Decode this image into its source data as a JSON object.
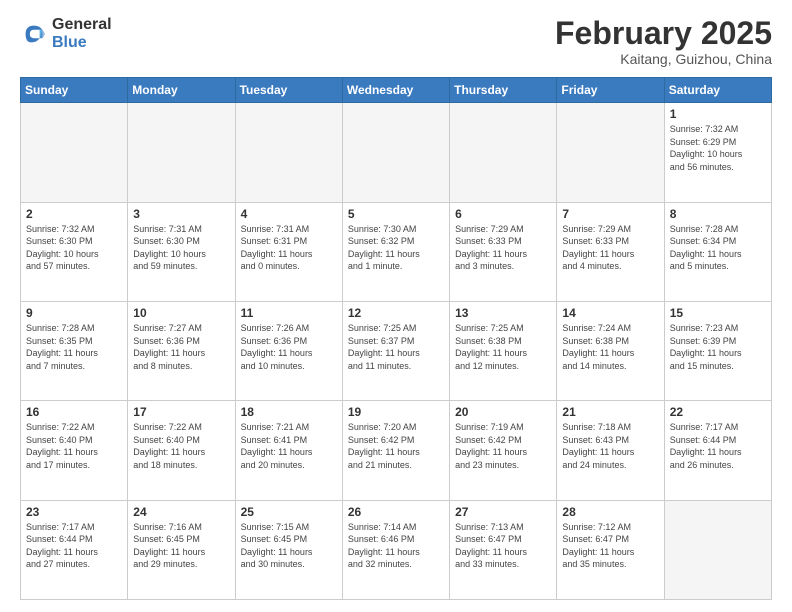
{
  "header": {
    "logo": {
      "general": "General",
      "blue": "Blue"
    },
    "title": "February 2025",
    "location": "Kaitang, Guizhou, China"
  },
  "calendar": {
    "days_of_week": [
      "Sunday",
      "Monday",
      "Tuesday",
      "Wednesday",
      "Thursday",
      "Friday",
      "Saturday"
    ],
    "weeks": [
      {
        "shaded": false,
        "days": [
          {
            "num": "",
            "info": ""
          },
          {
            "num": "",
            "info": ""
          },
          {
            "num": "",
            "info": ""
          },
          {
            "num": "",
            "info": ""
          },
          {
            "num": "",
            "info": ""
          },
          {
            "num": "",
            "info": ""
          },
          {
            "num": "1",
            "info": "Sunrise: 7:32 AM\nSunset: 6:29 PM\nDaylight: 10 hours\nand 56 minutes."
          }
        ]
      },
      {
        "shaded": false,
        "days": [
          {
            "num": "2",
            "info": "Sunrise: 7:32 AM\nSunset: 6:30 PM\nDaylight: 10 hours\nand 57 minutes."
          },
          {
            "num": "3",
            "info": "Sunrise: 7:31 AM\nSunset: 6:30 PM\nDaylight: 10 hours\nand 59 minutes."
          },
          {
            "num": "4",
            "info": "Sunrise: 7:31 AM\nSunset: 6:31 PM\nDaylight: 11 hours\nand 0 minutes."
          },
          {
            "num": "5",
            "info": "Sunrise: 7:30 AM\nSunset: 6:32 PM\nDaylight: 11 hours\nand 1 minute."
          },
          {
            "num": "6",
            "info": "Sunrise: 7:29 AM\nSunset: 6:33 PM\nDaylight: 11 hours\nand 3 minutes."
          },
          {
            "num": "7",
            "info": "Sunrise: 7:29 AM\nSunset: 6:33 PM\nDaylight: 11 hours\nand 4 minutes."
          },
          {
            "num": "8",
            "info": "Sunrise: 7:28 AM\nSunset: 6:34 PM\nDaylight: 11 hours\nand 5 minutes."
          }
        ]
      },
      {
        "shaded": true,
        "days": [
          {
            "num": "9",
            "info": "Sunrise: 7:28 AM\nSunset: 6:35 PM\nDaylight: 11 hours\nand 7 minutes."
          },
          {
            "num": "10",
            "info": "Sunrise: 7:27 AM\nSunset: 6:36 PM\nDaylight: 11 hours\nand 8 minutes."
          },
          {
            "num": "11",
            "info": "Sunrise: 7:26 AM\nSunset: 6:36 PM\nDaylight: 11 hours\nand 10 minutes."
          },
          {
            "num": "12",
            "info": "Sunrise: 7:25 AM\nSunset: 6:37 PM\nDaylight: 11 hours\nand 11 minutes."
          },
          {
            "num": "13",
            "info": "Sunrise: 7:25 AM\nSunset: 6:38 PM\nDaylight: 11 hours\nand 12 minutes."
          },
          {
            "num": "14",
            "info": "Sunrise: 7:24 AM\nSunset: 6:38 PM\nDaylight: 11 hours\nand 14 minutes."
          },
          {
            "num": "15",
            "info": "Sunrise: 7:23 AM\nSunset: 6:39 PM\nDaylight: 11 hours\nand 15 minutes."
          }
        ]
      },
      {
        "shaded": false,
        "days": [
          {
            "num": "16",
            "info": "Sunrise: 7:22 AM\nSunset: 6:40 PM\nDaylight: 11 hours\nand 17 minutes."
          },
          {
            "num": "17",
            "info": "Sunrise: 7:22 AM\nSunset: 6:40 PM\nDaylight: 11 hours\nand 18 minutes."
          },
          {
            "num": "18",
            "info": "Sunrise: 7:21 AM\nSunset: 6:41 PM\nDaylight: 11 hours\nand 20 minutes."
          },
          {
            "num": "19",
            "info": "Sunrise: 7:20 AM\nSunset: 6:42 PM\nDaylight: 11 hours\nand 21 minutes."
          },
          {
            "num": "20",
            "info": "Sunrise: 7:19 AM\nSunset: 6:42 PM\nDaylight: 11 hours\nand 23 minutes."
          },
          {
            "num": "21",
            "info": "Sunrise: 7:18 AM\nSunset: 6:43 PM\nDaylight: 11 hours\nand 24 minutes."
          },
          {
            "num": "22",
            "info": "Sunrise: 7:17 AM\nSunset: 6:44 PM\nDaylight: 11 hours\nand 26 minutes."
          }
        ]
      },
      {
        "shaded": true,
        "days": [
          {
            "num": "23",
            "info": "Sunrise: 7:17 AM\nSunset: 6:44 PM\nDaylight: 11 hours\nand 27 minutes."
          },
          {
            "num": "24",
            "info": "Sunrise: 7:16 AM\nSunset: 6:45 PM\nDaylight: 11 hours\nand 29 minutes."
          },
          {
            "num": "25",
            "info": "Sunrise: 7:15 AM\nSunset: 6:45 PM\nDaylight: 11 hours\nand 30 minutes."
          },
          {
            "num": "26",
            "info": "Sunrise: 7:14 AM\nSunset: 6:46 PM\nDaylight: 11 hours\nand 32 minutes."
          },
          {
            "num": "27",
            "info": "Sunrise: 7:13 AM\nSunset: 6:47 PM\nDaylight: 11 hours\nand 33 minutes."
          },
          {
            "num": "28",
            "info": "Sunrise: 7:12 AM\nSunset: 6:47 PM\nDaylight: 11 hours\nand 35 minutes."
          },
          {
            "num": "",
            "info": ""
          }
        ]
      }
    ]
  }
}
